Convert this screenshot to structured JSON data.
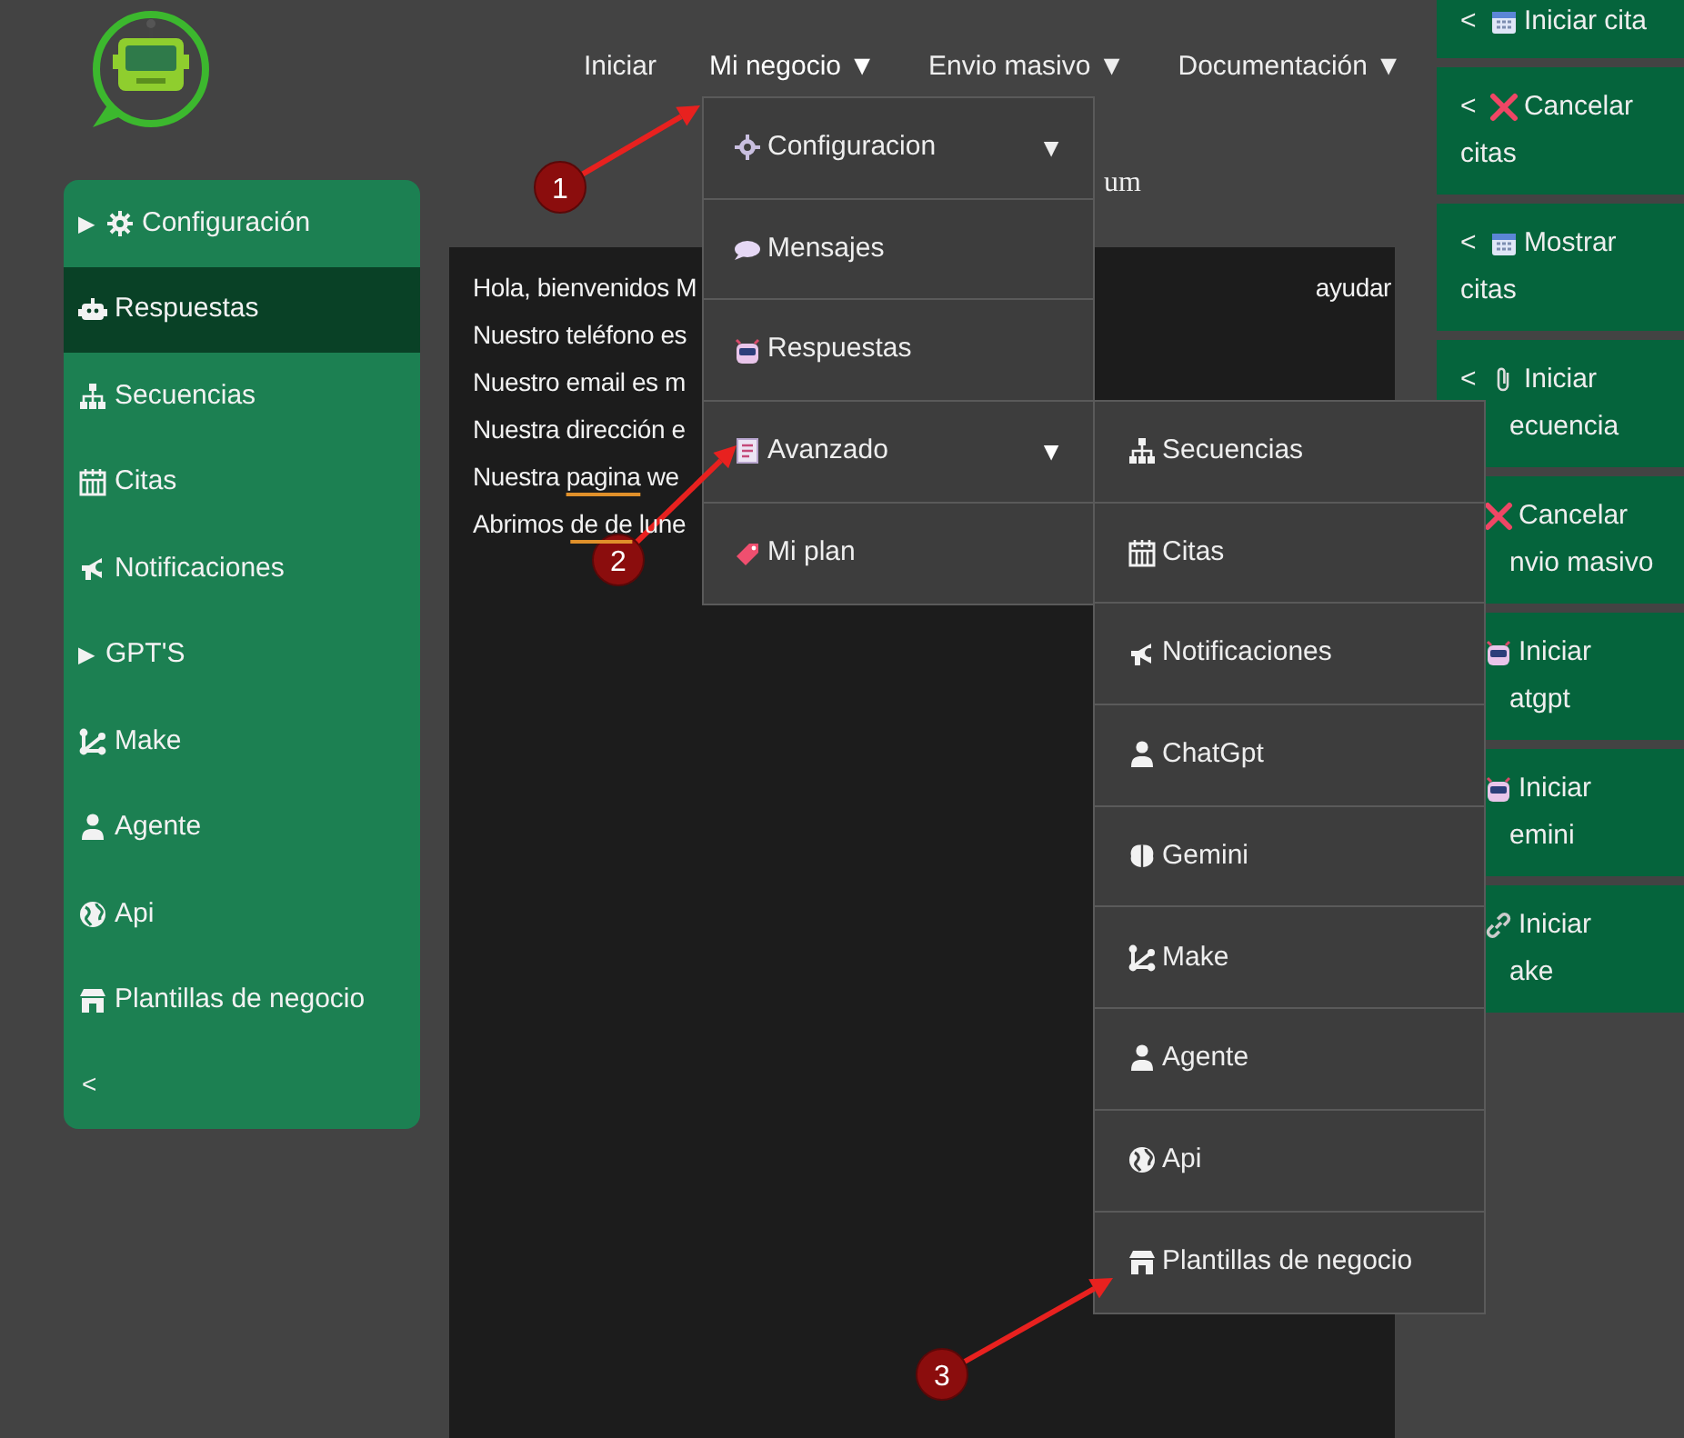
{
  "nav": [
    {
      "label": "Iniciar",
      "expanded": false
    },
    {
      "label": "Mi negocio",
      "caret": "▼",
      "expanded": true
    },
    {
      "label": "Envio masivo",
      "caret": "▼",
      "expanded": false
    },
    {
      "label": "Documentación",
      "caret": "▼",
      "expanded": false
    }
  ],
  "dropdown": [
    {
      "label": "Configuracion",
      "caret": "▼",
      "expanded": false
    },
    {
      "label": "Mensajes"
    },
    {
      "label": "Respuestas"
    },
    {
      "label": "Avanzado",
      "caret": "▼",
      "expanded": true,
      "children": [
        {
          "label": "Secuencias"
        },
        {
          "label": "Citas"
        },
        {
          "label": "Notificaciones"
        },
        {
          "label": "ChatGpt"
        },
        {
          "label": "Gemini"
        },
        {
          "label": "Make"
        },
        {
          "label": "Agente"
        },
        {
          "label": "Api"
        },
        {
          "label": "Plantillas de negocio"
        }
      ]
    },
    {
      "label": "Mi plan"
    }
  ],
  "sidebar": {
    "items": [
      {
        "label": "Configuración",
        "toggle": "▶",
        "selected": false
      },
      {
        "label": "Respuestas",
        "selected": true
      },
      {
        "label": "Secuencias",
        "selected": false
      },
      {
        "label": "Citas",
        "selected": false
      },
      {
        "label": "Notificaciones",
        "selected": false
      },
      {
        "label": "GPT'S",
        "toggle": "▶",
        "selected": false
      },
      {
        "label": "Make",
        "selected": false
      },
      {
        "label": "Agente",
        "selected": false
      },
      {
        "label": "Api",
        "selected": false
      },
      {
        "label": "Plantillas de negocio",
        "selected": false
      }
    ],
    "collapse": "<"
  },
  "heading_fragment": "um",
  "editor": {
    "lines": [
      {
        "parts": [
          {
            "text": "Hola, bienvenidos M"
          }
        ],
        "trailing": "ayudar"
      },
      {
        "parts": [
          {
            "text": "Nuestro teléfono es"
          }
        ]
      },
      {
        "parts": [
          {
            "text": "Nuestro email es m"
          }
        ]
      },
      {
        "parts": [
          {
            "text": "Nuestra dirección e"
          }
        ]
      },
      {
        "parts": [
          {
            "text": "Nuestra "
          },
          {
            "text": "pagina",
            "misspelled": true
          },
          {
            "text": " we"
          }
        ]
      },
      {
        "parts": [
          {
            "text": "Abrimos "
          },
          {
            "text": "de de",
            "misspelled": true
          },
          {
            "text": " lune"
          }
        ]
      }
    ]
  },
  "shortcuts": [
    {
      "prefix": "<",
      "lines": [
        "Iniciar cita"
      ]
    },
    {
      "prefix": "<",
      "lines": [
        "Cancelar",
        "citas"
      ]
    },
    {
      "prefix": "<",
      "lines": [
        "Mostrar",
        "citas"
      ]
    },
    {
      "prefix": "<",
      "lines": [
        "Iniciar",
        "ecuencia"
      ]
    },
    {
      "lines": [
        "Cancelar",
        "nvio masivo"
      ]
    },
    {
      "lines": [
        "Iniciar",
        "atgpt"
      ]
    },
    {
      "lines": [
        "Iniciar",
        "emini"
      ]
    },
    {
      "lines": [
        "Iniciar",
        "ake"
      ]
    }
  ],
  "annotations": [
    {
      "number": "1"
    },
    {
      "number": "2"
    },
    {
      "number": "3"
    }
  ]
}
